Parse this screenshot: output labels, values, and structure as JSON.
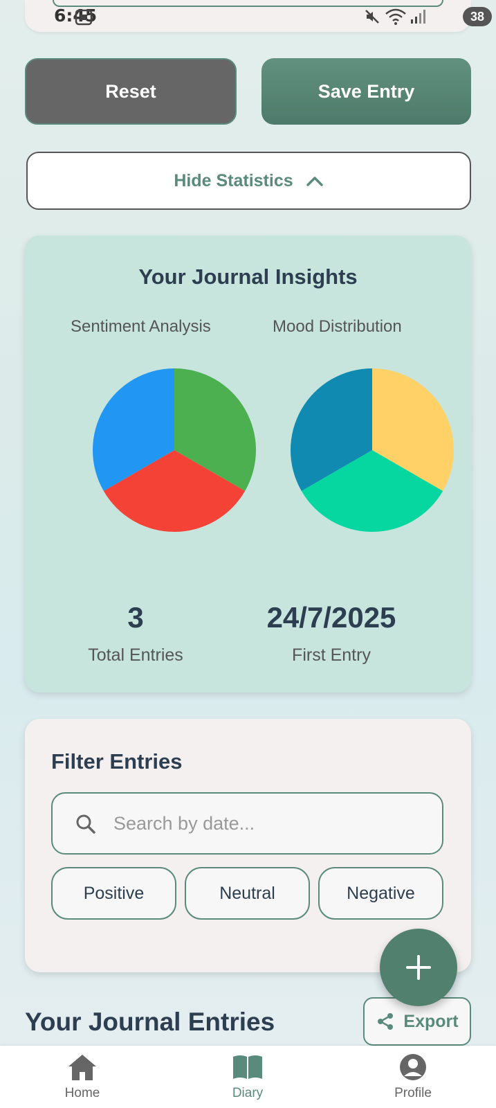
{
  "status_bar": {
    "time": "6:45",
    "battery": "38",
    "icons": [
      "screenshot-icon",
      "mute-icon",
      "wifi-icon",
      "signal-icon",
      "battery-icon"
    ]
  },
  "actions": {
    "reset_label": "Reset",
    "save_label": "Save Entry",
    "hide_stats_label": "Hide Statistics"
  },
  "insights": {
    "title": "Your Journal Insights",
    "sentiment_label": "Sentiment Analysis",
    "mood_label": "Mood Distribution",
    "total_entries_value": "3",
    "total_entries_label": "Total Entries",
    "first_entry_value": "24/7/2025",
    "first_entry_label": "First Entry"
  },
  "chart_data": [
    {
      "type": "pie",
      "title": "Sentiment Analysis",
      "slices": [
        {
          "value": 1,
          "color": "#4caf50"
        },
        {
          "value": 1,
          "color": "#f44336"
        },
        {
          "value": 1,
          "color": "#2196f3"
        }
      ]
    },
    {
      "type": "pie",
      "title": "Mood Distribution",
      "slices": [
        {
          "value": 1,
          "color": "#ffd166"
        },
        {
          "value": 1,
          "color": "#06d6a0"
        },
        {
          "value": 1,
          "color": "#118ab2"
        }
      ]
    }
  ],
  "filter": {
    "title": "Filter Entries",
    "search_placeholder": "Search by date...",
    "chips": [
      "Positive",
      "Neutral",
      "Negative"
    ]
  },
  "entries": {
    "title": "Your Journal Entries",
    "export_label": "Export"
  },
  "nav": {
    "items": [
      {
        "label": "Home",
        "icon": "home-icon",
        "active": false
      },
      {
        "label": "Diary",
        "icon": "book-icon",
        "active": true
      },
      {
        "label": "Profile",
        "icon": "profile-icon",
        "active": false
      }
    ]
  },
  "colors": {
    "accent": "#5a8a7c",
    "insights_bg": "#c7e5dd",
    "card_bg": "#f5f0f0"
  }
}
